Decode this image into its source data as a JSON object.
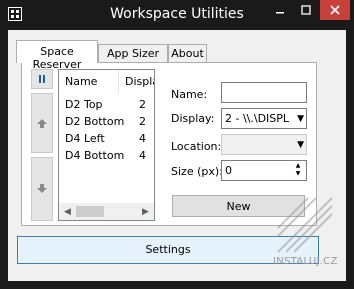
{
  "window": {
    "title": "Workspace Utilities",
    "icon": "app-icon"
  },
  "tabs": [
    {
      "label": "Space Reserver",
      "active": true
    },
    {
      "label": "App Sizer",
      "active": false
    },
    {
      "label": "About",
      "active": false
    }
  ],
  "side_buttons": [
    "pause-icon",
    "arrow-up-icon",
    "arrow-down-icon"
  ],
  "list": {
    "columns": [
      "Name",
      "Displa"
    ],
    "rows": [
      {
        "name": "D2 Top",
        "display": "2"
      },
      {
        "name": "D2 Bottom",
        "display": "2"
      },
      {
        "name": "D4 Left",
        "display": "4"
      },
      {
        "name": "D4 Bottom",
        "display": "4"
      }
    ]
  },
  "form": {
    "name_label": "Name:",
    "name_value": "",
    "display_label": "Display:",
    "display_value": "2 - \\\\.\\DISPL",
    "location_label": "Location:",
    "location_value": "",
    "size_label": "Size (px):",
    "size_value": "0"
  },
  "buttons": {
    "new": "New",
    "settings": "Settings"
  },
  "watermark": {
    "text": "INSTALUJ.CZ"
  },
  "colors": {
    "titlebar": "#1a1a1a",
    "close": "#c7413b",
    "accent": "#3c7fb1"
  }
}
